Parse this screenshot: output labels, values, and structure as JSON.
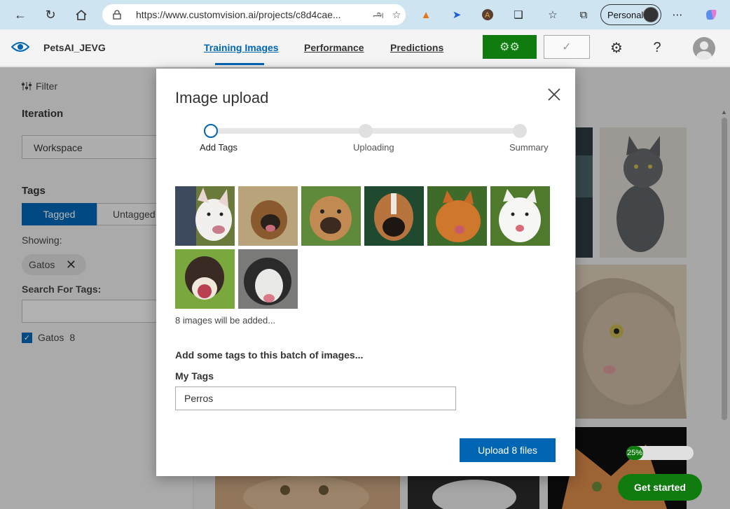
{
  "browser": {
    "url": "https://www.customvision.ai/projects/c8d4cae...",
    "profile_label": "Personal"
  },
  "header": {
    "project_name": "PetsAI_JEVG",
    "tabs": [
      {
        "label": "Training Images",
        "active": true
      },
      {
        "label": "Performance",
        "active": false
      },
      {
        "label": "Predictions",
        "active": false
      }
    ]
  },
  "sidebar": {
    "filter_label": "Filter",
    "iteration_heading": "Iteration",
    "iteration_value": "Workspace",
    "tags_heading": "Tags",
    "tagged_label": "Tagged",
    "untagged_label": "Untagged",
    "showing_label": "Showing:",
    "showing_chip": "Gatos",
    "search_label": "Search For Tags:",
    "tag_items": [
      {
        "name": "Gatos",
        "count": "8",
        "checked": true
      }
    ]
  },
  "progress": {
    "label": "25%",
    "value": 0.25
  },
  "get_started_label": "Get started",
  "modal": {
    "title": "Image upload",
    "steps": [
      {
        "label": "Add Tags",
        "current": true
      },
      {
        "label": "Uploading",
        "current": false
      },
      {
        "label": "Summary",
        "current": false
      }
    ],
    "images_note": "8 images will be added...",
    "tags_heading": "Add some tags to this batch of images...",
    "my_tags_label": "My Tags",
    "my_tags_value": "Perros",
    "upload_button": "Upload 8 files"
  },
  "colors": {
    "accent": "#0066b4",
    "train_green": "#107c10"
  }
}
